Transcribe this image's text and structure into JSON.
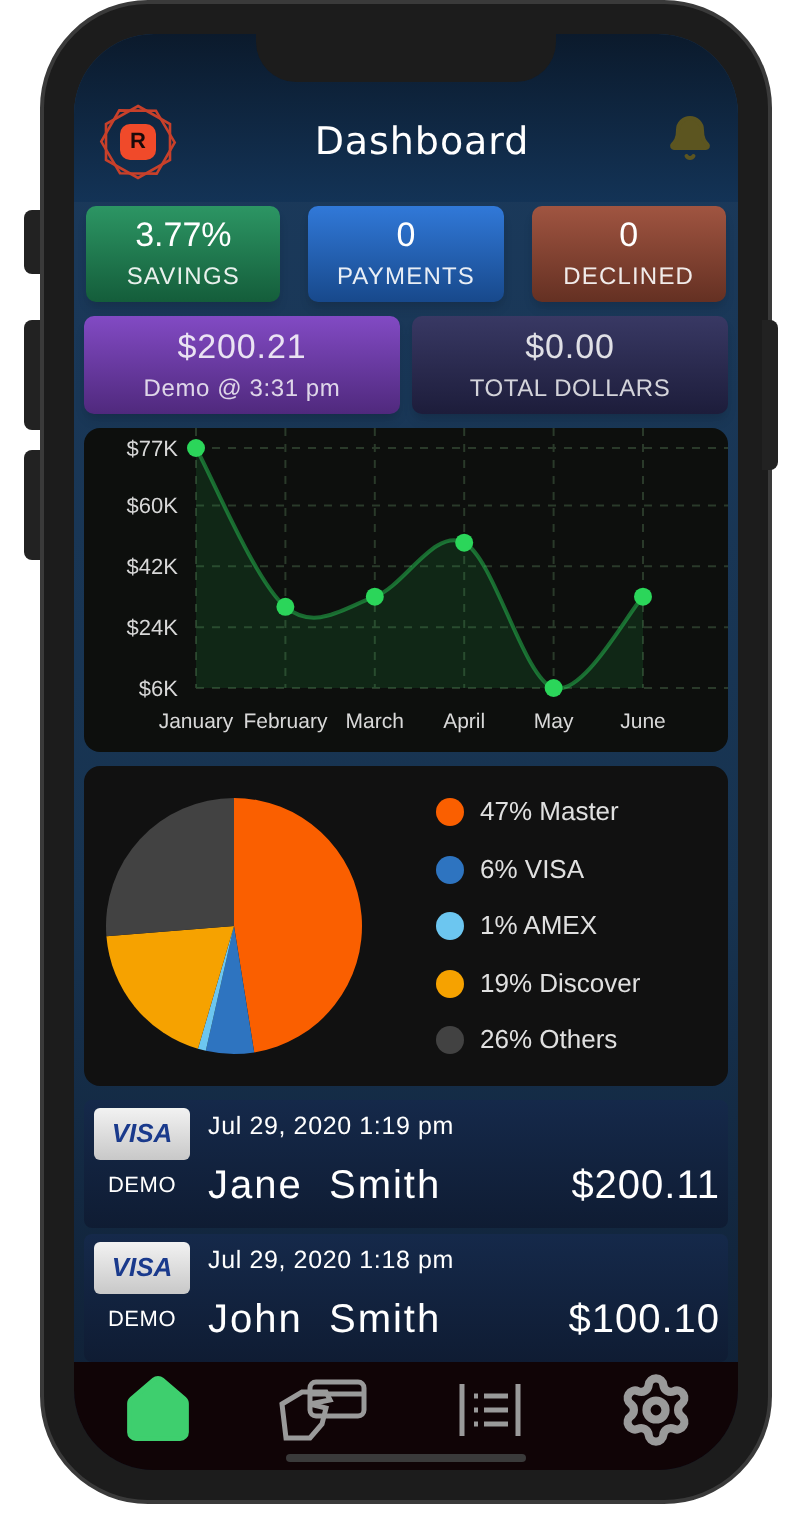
{
  "header": {
    "logo_letter": "R",
    "title": "Dashboard"
  },
  "stats": [
    {
      "value": "3.77%",
      "label": "SAVINGS",
      "color": "#1f8f5a"
    },
    {
      "value": "0",
      "label": "PAYMENTS",
      "color": "#2470d6"
    },
    {
      "value": "0",
      "label": "DECLINED",
      "color": "#9a4a35"
    }
  ],
  "summary": [
    {
      "value": "$200.21",
      "label": "Demo @ 3:31 pm",
      "color": "#7a3fc0"
    },
    {
      "value": "$0.00",
      "label": "TOTAL DOLLARS",
      "color": "#2c2c5a"
    }
  ],
  "line_card": {
    "chart_data": {
      "type": "area",
      "categories": [
        "January",
        "February",
        "March",
        "April",
        "May",
        "June"
      ],
      "series": [
        {
          "color": "#2bd65a",
          "values": [
            77,
            30,
            33,
            49,
            6,
            33
          ]
        }
      ],
      "grid": true,
      "ylim": [
        6,
        77
      ],
      "yticks": [
        {
          "value": 6,
          "label": "$6K"
        },
        {
          "value": 24,
          "label": "$24K"
        },
        {
          "value": 42,
          "label": "$42K"
        },
        {
          "value": 60,
          "label": "$60K"
        },
        {
          "value": 77,
          "label": "$77K"
        }
      ]
    }
  },
  "pie_card": {
    "chart_data": {
      "type": "pie",
      "series": [
        {
          "values": [
            47,
            6,
            1,
            19,
            26
          ]
        }
      ]
    },
    "legend": [
      {
        "label": "47% Master",
        "color": "#fa5f00"
      },
      {
        "label": "6% VISA",
        "color": "#2e74c0"
      },
      {
        "label": "1% AMEX",
        "color": "#6cc6f0"
      },
      {
        "label": "19% Discover",
        "color": "#f6a200"
      },
      {
        "label": "26% Others",
        "color": "#424242"
      }
    ]
  },
  "transactions": [
    {
      "card": "VISA",
      "tag": "DEMO",
      "date": "Jul 29, 2020 1:19 pm",
      "name": "Jane  Smith",
      "amount": "$200.11"
    },
    {
      "card": "VISA",
      "tag": "DEMO",
      "date": "Jul 29, 2020 1:18 pm",
      "name": "John  Smith",
      "amount": "$100.10"
    }
  ],
  "nav": [
    {
      "kind": "home",
      "selected": true
    },
    {
      "kind": "card",
      "selected": false
    },
    {
      "kind": "list",
      "selected": false
    },
    {
      "kind": "settings",
      "selected": false
    }
  ]
}
